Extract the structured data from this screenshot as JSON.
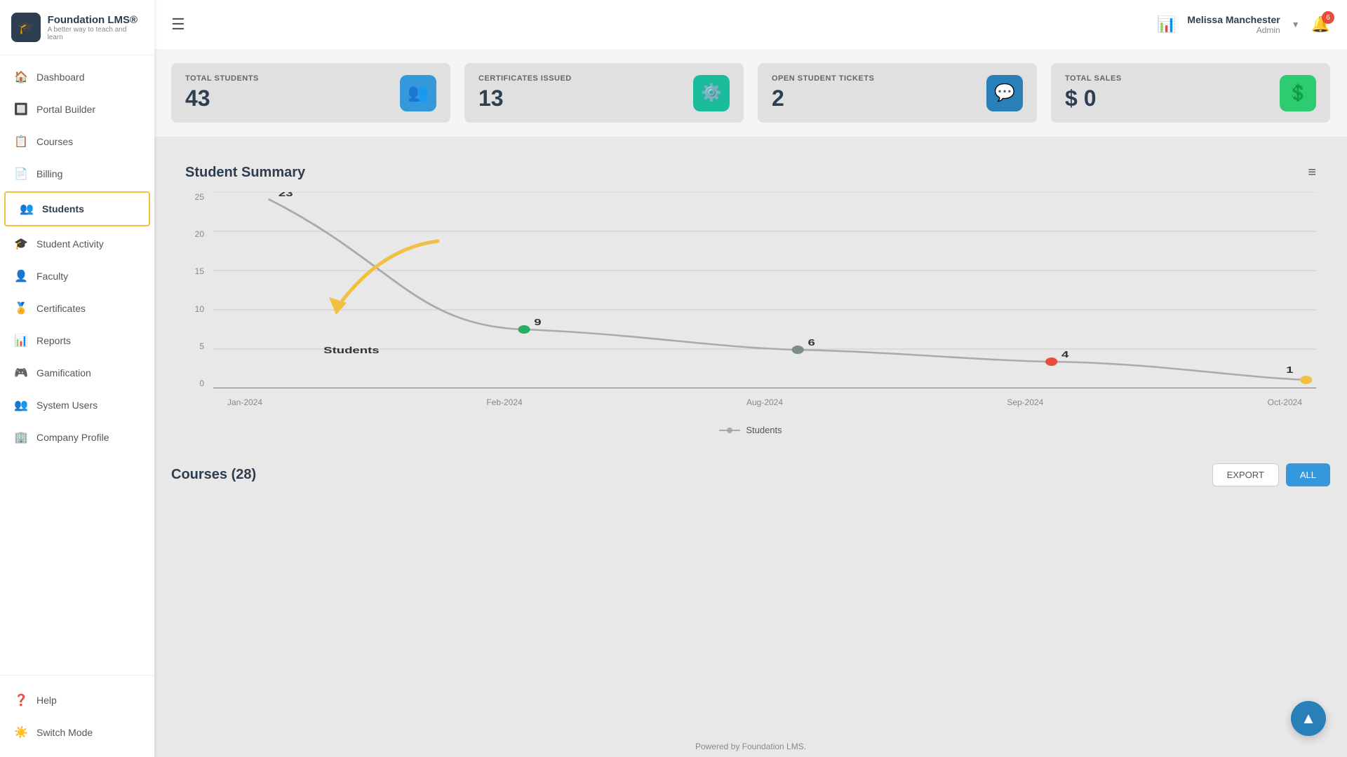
{
  "app": {
    "name": "Foundation LMS®",
    "tagline": "A better way to teach and learn"
  },
  "sidebar": {
    "items": [
      {
        "id": "dashboard",
        "label": "Dashboard",
        "icon": "🏠",
        "active": false
      },
      {
        "id": "portal-builder",
        "label": "Portal Builder",
        "icon": "🔲",
        "active": false
      },
      {
        "id": "courses",
        "label": "Courses",
        "icon": "📋",
        "active": false
      },
      {
        "id": "billing",
        "label": "Billing",
        "icon": "📄",
        "active": false
      },
      {
        "id": "students",
        "label": "Students",
        "icon": "👥",
        "active": true
      },
      {
        "id": "student-activity",
        "label": "Student Activity",
        "icon": "🎓",
        "active": false
      },
      {
        "id": "faculty",
        "label": "Faculty",
        "icon": "👤",
        "active": false
      },
      {
        "id": "certificates",
        "label": "Certificates",
        "icon": "🏅",
        "active": false
      },
      {
        "id": "reports",
        "label": "Reports",
        "icon": "📊",
        "active": false
      },
      {
        "id": "gamification",
        "label": "Gamification",
        "icon": "🎮",
        "active": false
      },
      {
        "id": "system-users",
        "label": "System Users",
        "icon": "👥",
        "active": false
      },
      {
        "id": "company-profile",
        "label": "Company Profile",
        "icon": "🏢",
        "active": false
      }
    ],
    "bottom_items": [
      {
        "id": "help",
        "label": "Help",
        "icon": "❓"
      },
      {
        "id": "switch-mode",
        "label": "Switch Mode",
        "icon": "☀️"
      }
    ]
  },
  "header": {
    "hamburger_label": "☰",
    "analytics_icon": "📊",
    "user_name": "Melissa Manchester",
    "user_role": "Admin",
    "notification_count": "6"
  },
  "stats": [
    {
      "id": "total-students",
      "label": "TOTAL STUDENTS",
      "value": "43",
      "icon": "👥",
      "icon_class": "blue"
    },
    {
      "id": "certificates-issued",
      "label": "CERTIFICATES ISSUED",
      "value": "13",
      "icon": "⚙️",
      "icon_class": "teal"
    },
    {
      "id": "open-tickets",
      "label": "OPEN STUDENT TICKETS",
      "value": "2",
      "icon": "💬",
      "icon_class": "blue2"
    },
    {
      "id": "total-sales",
      "label": "TOTAL SALES",
      "value": "$ 0",
      "icon": "💲",
      "icon_class": "green"
    }
  ],
  "chart": {
    "title": "Student Summary",
    "y_labels": [
      "25",
      "20",
      "15",
      "10",
      "5",
      "0"
    ],
    "x_labels": [
      "Jan-2024",
      "Feb-2024",
      "Aug-2024",
      "Sep-2024",
      "Oct-2024"
    ],
    "data_points": [
      {
        "month": "Jan-2024",
        "value": 23,
        "color": "#999",
        "x_pct": 5
      },
      {
        "month": "Feb-2024",
        "value": 9,
        "color": "#27ae60",
        "x_pct": 28
      },
      {
        "month": "Aug-2024",
        "value": 6,
        "color": "#7f8c8d",
        "x_pct": 53
      },
      {
        "month": "Sep-2024",
        "value": 4,
        "color": "#e74c3c",
        "x_pct": 76
      },
      {
        "month": "Oct-2024",
        "value": 1,
        "color": "#f0c040",
        "x_pct": 99
      }
    ],
    "legend_label": "Students",
    "students_label": "Students",
    "menu_icon": "≡"
  },
  "courses": {
    "title": "Courses",
    "count": "28",
    "export_btn": "EXPORT",
    "all_btn": "ALL"
  },
  "footer": {
    "text": "Powered by Foundation LMS."
  },
  "scroll_top": {
    "icon": "▲"
  }
}
